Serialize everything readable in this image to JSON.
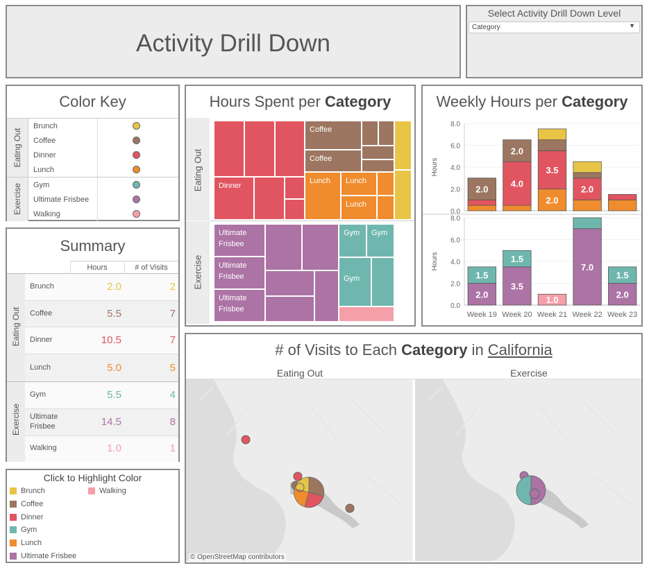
{
  "header": {
    "title": "Activity Drill Down"
  },
  "drilldown": {
    "label": "Select Activity Drill Down Level",
    "selected": "Category"
  },
  "colors": {
    "Brunch": "#e8c547",
    "Coffee": "#9c7660",
    "Dinner": "#e05560",
    "Lunch": "#ef8c2e",
    "Gym": "#6fb7ae",
    "Ultimate Frisbee": "#ac73a5",
    "Walking": "#f59fa8"
  },
  "color_key": {
    "title": "Color Key",
    "groups": [
      {
        "name": "Eating Out",
        "items": [
          "Brunch",
          "Coffee",
          "Dinner",
          "Lunch"
        ]
      },
      {
        "name": "Exercise",
        "items": [
          "Gym",
          "Ultimate Frisbee",
          "Walking"
        ]
      }
    ]
  },
  "summary": {
    "title": "Summary",
    "col_hours": "Hours",
    "col_visits": "# of Visits",
    "groups": [
      {
        "name": "Eating Out",
        "rows": [
          {
            "name": "Brunch",
            "hours": "2.0",
            "visits": "2"
          },
          {
            "name": "Coffee",
            "hours": "5.5",
            "visits": "7"
          },
          {
            "name": "Dinner",
            "hours": "10.5",
            "visits": "7"
          },
          {
            "name": "Lunch",
            "hours": "5.0",
            "visits": "5"
          }
        ]
      },
      {
        "name": "Exercise",
        "rows": [
          {
            "name": "Gym",
            "hours": "5.5",
            "visits": "4"
          },
          {
            "name": "Ultimate Frisbee",
            "hours": "14.5",
            "visits": "8"
          },
          {
            "name": "Walking",
            "hours": "1.0",
            "visits": "1"
          }
        ]
      }
    ]
  },
  "highlight": {
    "title": "Click to Highlight Color",
    "items": [
      "Brunch",
      "Walking",
      "Coffee",
      "Dinner",
      "Gym",
      "Lunch",
      "Ultimate Frisbee"
    ]
  },
  "treemap": {
    "title_prefix": "Hours Spent per ",
    "title_bold": "Category",
    "groups": [
      "Eating Out",
      "Exercise"
    ],
    "labels": {
      "coffee1": "Coffee",
      "coffee2": "Coffee",
      "dinner": "Dinner",
      "lunch1": "Lunch",
      "lunch2": "Lunch",
      "lunch3": "Lunch",
      "uf1": "Ultimate Frisbee",
      "uf2": "Ultimate Frisbee",
      "uf3": "Ultimate Frisbee",
      "gym1": "Gym",
      "gym2": "Gym",
      "gym3": "Gym"
    }
  },
  "weekly": {
    "title_prefix": "Weekly Hours per ",
    "title_bold": "Category",
    "ylabel": "Hours"
  },
  "map": {
    "title_prefix": "# of Visits to Each ",
    "title_bold": "Category",
    "title_mid": " in ",
    "title_link": "California",
    "panel_left": "Eating Out",
    "panel_right": "Exercise",
    "attribution": "© OpenStreetMap contributors"
  },
  "chart_data": [
    {
      "type": "bar",
      "title": "Weekly Hours per Category — Eating Out",
      "ylabel": "Hours",
      "ylim": [
        0,
        8
      ],
      "yticks": [
        "0.0",
        "2.0",
        "4.0",
        "6.0",
        "8.0"
      ],
      "categories": [
        "Week 19",
        "Week 20",
        "Week 21",
        "Week 22",
        "Week 23"
      ],
      "stacked": true,
      "series": [
        {
          "name": "Lunch",
          "values": [
            0.5,
            0.5,
            2.0,
            1.0,
            1.0
          ],
          "labels": [
            "",
            "",
            "2.0",
            "",
            ""
          ]
        },
        {
          "name": "Dinner",
          "values": [
            0.5,
            4.0,
            3.5,
            2.0,
            0.5
          ],
          "labels": [
            "",
            "4.0",
            "3.5",
            "2.0",
            ""
          ]
        },
        {
          "name": "Coffee",
          "values": [
            2.0,
            2.0,
            1.0,
            0.5,
            0
          ],
          "labels": [
            "2.0",
            "2.0",
            "",
            "",
            ""
          ]
        },
        {
          "name": "Brunch",
          "values": [
            0,
            0,
            1.0,
            1.0,
            0
          ],
          "labels": [
            "",
            "",
            "",
            "",
            ""
          ]
        }
      ]
    },
    {
      "type": "bar",
      "title": "Weekly Hours per Category — Exercise",
      "ylabel": "Hours",
      "ylim": [
        0,
        8
      ],
      "yticks": [
        "0.0",
        "2.0",
        "4.0",
        "6.0",
        "8.0"
      ],
      "categories": [
        "Week 19",
        "Week 20",
        "Week 21",
        "Week 22",
        "Week 23"
      ],
      "stacked": true,
      "series": [
        {
          "name": "Ultimate Frisbee",
          "values": [
            2.0,
            3.5,
            0,
            7.0,
            2.0
          ],
          "labels": [
            "2.0",
            "3.5",
            "",
            "7.0",
            "2.0"
          ]
        },
        {
          "name": "Walking",
          "values": [
            0,
            0,
            1.0,
            0,
            0
          ],
          "labels": [
            "",
            "",
            "1.0",
            "",
            ""
          ]
        },
        {
          "name": "Gym",
          "values": [
            1.5,
            1.5,
            0,
            1.0,
            1.5
          ],
          "labels": [
            "1.5",
            "1.5",
            "",
            "",
            "1.5"
          ]
        }
      ]
    }
  ]
}
